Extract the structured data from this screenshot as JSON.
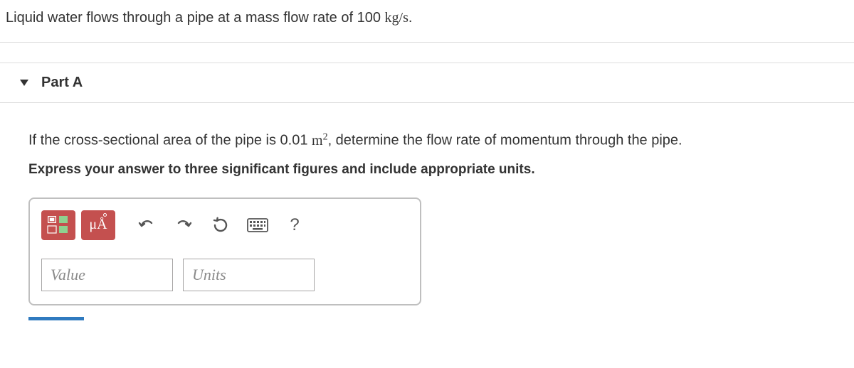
{
  "problem": {
    "text_before": "Liquid water flows through a pipe at a mass flow rate of 100 ",
    "units": "kg/s",
    "text_after": "."
  },
  "part": {
    "label": "Part A",
    "question_before": "If the cross-sectional area of the pipe is 0.01 ",
    "question_unit_base": "m",
    "question_unit_exp": "2",
    "question_after": ", determine the flow rate of momentum through the pipe.",
    "instruction": "Express your answer to three significant figures and include appropriate units."
  },
  "toolbar": {
    "special_chars_label": "μÅ",
    "help_label": "?"
  },
  "inputs": {
    "value_placeholder": "Value",
    "units_placeholder": "Units"
  }
}
